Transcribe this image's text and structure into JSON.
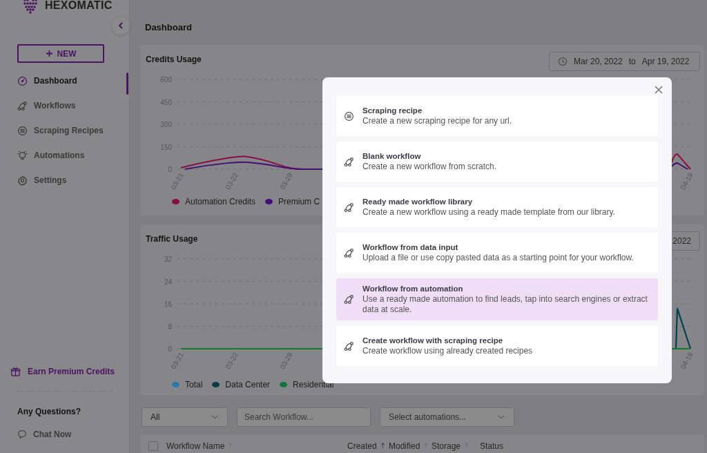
{
  "sidebar": {
    "logo": "HEXOMATIC",
    "new_button": "NEW",
    "items": [
      {
        "label": "Dashboard",
        "selected": true
      },
      {
        "label": "Workflows",
        "selected": false
      },
      {
        "label": "Scraping Recipes",
        "selected": false
      },
      {
        "label": "Automations",
        "selected": false
      },
      {
        "label": "Settings",
        "selected": false
      }
    ],
    "earn_link": "Earn Premium Credits",
    "questions_title": "Any Questions?",
    "chat_link": "Chat Now"
  },
  "header": {
    "title": "Dashboard"
  },
  "credits_card": {
    "title": "Credits Usage",
    "date_from": "Mar 20, 2022",
    "date_separator": "to",
    "date_to": "Apr 19, 2022",
    "y_axis_labels": [
      "600",
      "450",
      "300",
      "150",
      "0"
    ],
    "x_axis_labels": [
      "03-21",
      "03-22",
      "03-29",
      "04-19"
    ],
    "legend": [
      {
        "label": "Automation Credits",
        "color": "#8a0e45"
      },
      {
        "label": "Premium C",
        "color": "#420e78"
      }
    ]
  },
  "traffic_card": {
    "title": "Traffic Usage",
    "date_to": "2022",
    "y_axis_labels": [
      "32",
      "24",
      "16",
      "8",
      "0"
    ],
    "x_axis_labels": [
      "03-21",
      "03-22",
      "03-29",
      "04-19"
    ],
    "legend": [
      {
        "label": "Total",
        "color": "#2a78a8"
      },
      {
        "label": "Data Center",
        "color": "#073c48"
      },
      {
        "label": "Residential",
        "color": "#14753a"
      }
    ]
  },
  "filters": {
    "status": "All",
    "search_placeholder": "Search Workflow...",
    "automations_placeholder": "Select automations..."
  },
  "table": {
    "all_selected": false,
    "columns": [
      {
        "label": "Workflow Name",
        "sorted": false
      },
      {
        "label": "Created",
        "sorted": true
      },
      {
        "label": "Modified",
        "sorted": false
      },
      {
        "label": "Storage",
        "sorted": false
      },
      {
        "label": "Status"
      }
    ]
  },
  "modal": {
    "items": [
      {
        "kind": "recipe",
        "title": "Scraping recipe",
        "description": "Create a new scraping recipe for any url.",
        "selected": false
      },
      {
        "kind": "workflow",
        "title": "Blank workflow",
        "description": "Create a new workflow from scratch.",
        "selected": false
      },
      {
        "kind": "workflow",
        "title": "Ready made workflow library",
        "description": "Create a new workflow using a ready made template from our library.",
        "selected": false
      },
      {
        "kind": "workflow",
        "title": "Workflow from data input",
        "description": "Upload a file or use copy pasted data as a starting point for your workflow.",
        "selected": false
      },
      {
        "kind": "workflow",
        "title": "Workflow from automation",
        "description": "Use a ready made automation to find leads, tap into search engines or extract data at scale.",
        "selected": true
      },
      {
        "kind": "workflow",
        "title": "Create workflow with scraping recipe",
        "description": "Create workflow using already created recipes",
        "selected": false
      }
    ]
  }
}
